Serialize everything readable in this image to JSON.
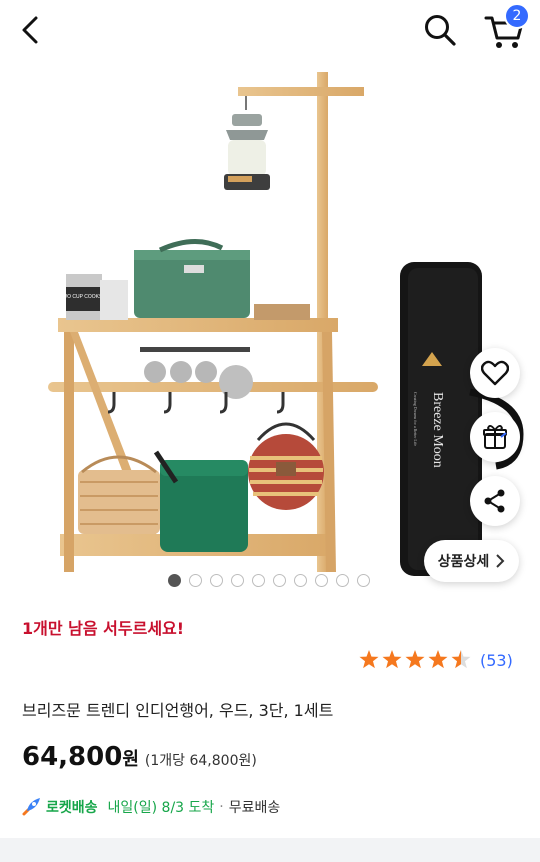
{
  "header": {
    "cart_count": "2"
  },
  "gallery": {
    "bag_brand": "Breeze Moon",
    "bag_tagline": "Creating Dreams for a Better Life",
    "box_label": "TWO CUP COOKSET",
    "slide_count": 10,
    "active_index": 0,
    "detail_label": "상품상세"
  },
  "product": {
    "urgency": "1개만 남음 서두르세요!",
    "rating": 4.5,
    "review_count": "(53)",
    "title": "브리즈문 트렌디 인디언행어, 우드, 3단, 1세트",
    "price": "64,800",
    "currency": "원",
    "unit_price": "(1개당 64,800원)"
  },
  "delivery": {
    "badge": "로켓배송",
    "arrival": "내일(일) 8/3 도착",
    "separator": "·",
    "shipping": "무료배송"
  },
  "colors": {
    "accent": "#346aff",
    "urgency": "#c8102e",
    "rocket": "#17a64a",
    "star": "#f5781e"
  }
}
